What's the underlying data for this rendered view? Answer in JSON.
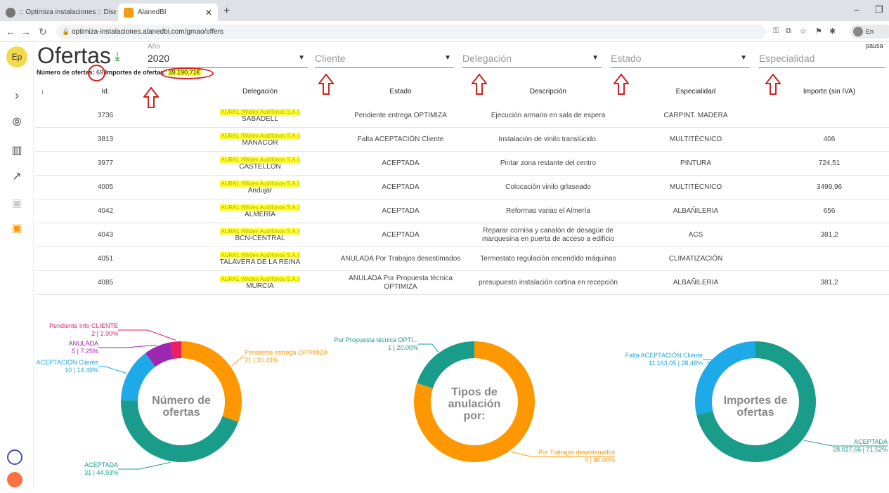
{
  "browser": {
    "tab1_title": ":: Optimiza instalaciones :: Diseño",
    "tab2_title": "AlanedBI",
    "url": "optimiza-instalaciones.alanedbi.com/gmao/offers",
    "pause_label": "En pausa"
  },
  "sidebar": {
    "avatar": "Ep"
  },
  "header": {
    "title": "Ofertas",
    "anio_label": "Año",
    "anio_value": "2020",
    "cliente_placeholder": "Cliente",
    "delegacion_placeholder": "Delegación",
    "estado_placeholder": "Estado",
    "especialidad_placeholder": "Especialidad",
    "num_label": "Número de ofertas:",
    "num_value": "69",
    "imp_label": "Importes de ofertas:",
    "imp_value": "39.190,71€"
  },
  "table": {
    "sort_icon": "↓",
    "columns": [
      "Id.",
      "Delegación",
      "Estado",
      "Descripción",
      "Especialidad",
      "Importe (sin IVA)"
    ],
    "rows": [
      {
        "id": "3736",
        "deleg_hl": "AURAL (Widex Audífonos S.A.)",
        "deleg": "SABADELL",
        "estado": "Pendiente entrega OPTIMIZA",
        "desc": "Ejecución armario en sala de espera",
        "esp": "CARPINT. MADERA",
        "imp": ""
      },
      {
        "id": "3813",
        "deleg_hl": "AURAL (Widex Audífonos S.A.)",
        "deleg": "MANACOR",
        "estado": "Falta ACEPTACIÓN Cliente",
        "desc": "Instalación de vinilo translúcido.",
        "esp": "MULTITÉCNICO",
        "imp": "406"
      },
      {
        "id": "3977",
        "deleg_hl": "AURAL (Widex Audífonos S.A.)",
        "deleg": "CASTELLON",
        "estado": "ACEPTADA",
        "desc": "Pintar zona restante del centro",
        "esp": "PINTURA",
        "imp": "724,51"
      },
      {
        "id": "4005",
        "deleg_hl": "AURAL (Widex Audífonos S.A.)",
        "deleg": "Andujar",
        "estado": "ACEPTADA",
        "desc": "Colocación vinilo grlaseado",
        "esp": "MULTITÉCNICO",
        "imp": "3499,96"
      },
      {
        "id": "4042",
        "deleg_hl": "AURAL (Widex Audífonos S.A.)",
        "deleg": "ALMERÍA",
        "estado": "ACEPTADA",
        "desc": "Reformas varias el Almería",
        "esp": "ALBAÑILERIA",
        "imp": "656"
      },
      {
        "id": "4043",
        "deleg_hl": "AURAL (Widex Audífonos S.A.)",
        "deleg": "BCN-CENTRAL",
        "estado": "ACEPTADA",
        "desc": "Reparar cornisa y canalón de desagüe de marquesina en puerta de acceso a edificio",
        "esp": "ACS",
        "imp": "381,2"
      },
      {
        "id": "4051",
        "deleg_hl": "AURAL (Widex Audífonos S.A.)",
        "deleg": "TALAVERA DE LA REINA",
        "estado": "ANULADA Por Trabajos desestimados",
        "desc": "Termostato regulación encendido máquinas",
        "esp": "CLIMATIZACIÓN",
        "imp": ""
      },
      {
        "id": "4085",
        "deleg_hl": "AURAL (Widex Audífonos S.A.)",
        "deleg": "MURCIA",
        "estado": "ANULADA Por Propuesta técnica OPTIMIZA",
        "desc": "presupuesto instalación cortina en recepción",
        "esp": "ALBAÑILERIA",
        "imp": "381,2"
      }
    ]
  },
  "chart_data": [
    {
      "type": "pie",
      "title": "Número de ofertas",
      "categories": [
        "Pendiente entrega OPTIMIZA",
        "ACEPTADA",
        "Falta ACEPTACIÓN Cliente",
        "ANULADA",
        "Pendiente info CLIENTE"
      ],
      "values": [
        21,
        31,
        10,
        5,
        2
      ],
      "percents": [
        "30.43%",
        "44.93%",
        "14.49%",
        "7.25%",
        "2.90%"
      ],
      "colors": [
        "#ff9800",
        "#1a9c8a",
        "#1ea9e8",
        "#9c27b0",
        "#e91e63"
      ]
    },
    {
      "type": "pie",
      "title": "Tipos de anulación por:",
      "categories": [
        "Por Trabajos desestimados",
        "Por Propuesta técnica OPTI..."
      ],
      "values": [
        4,
        1
      ],
      "percents": [
        "80.00%",
        "20.00%"
      ],
      "colors": [
        "#ff9800",
        "#1a9c8a"
      ]
    },
    {
      "type": "pie",
      "title": "Importes de ofertas",
      "categories": [
        "ACEPTADA",
        "Falta ACEPTACIÓN Cliente"
      ],
      "values": [
        28027.66,
        11163.05
      ],
      "value_labels": [
        "28.027,66",
        "11.163,05"
      ],
      "percents": [
        "71.52%",
        "28.48%"
      ],
      "colors": [
        "#1a9c8a",
        "#1ea9e8"
      ]
    }
  ]
}
